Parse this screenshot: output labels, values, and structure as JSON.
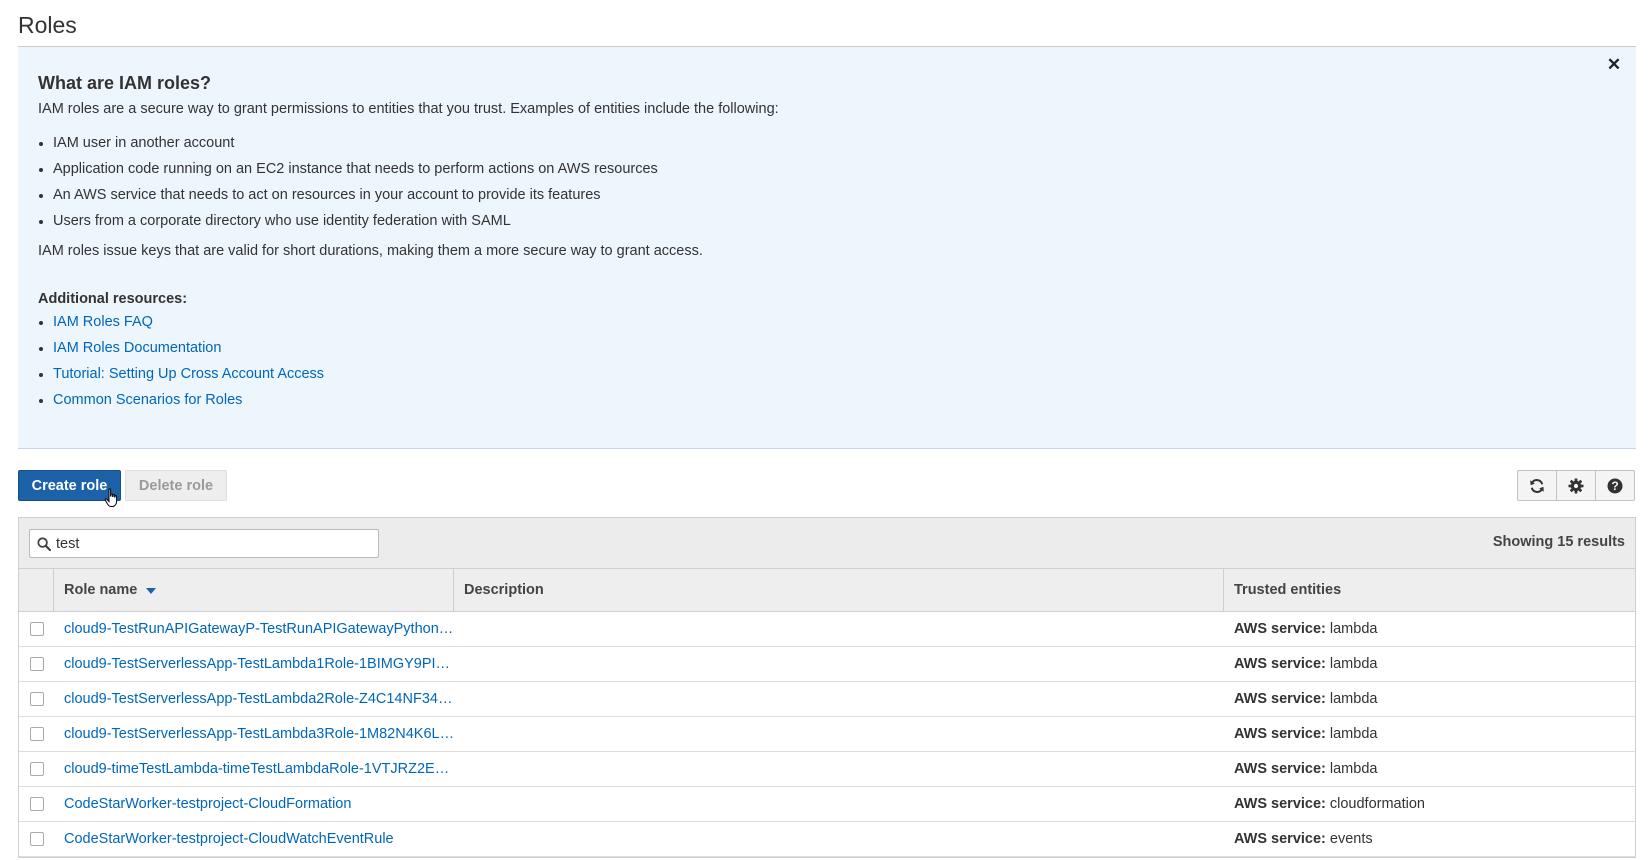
{
  "page": {
    "title": "Roles"
  },
  "info": {
    "heading": "What are IAM roles?",
    "intro": "IAM roles are a secure way to grant permissions to entities that you trust. Examples of entities include the following:",
    "examples": [
      "IAM user in another account",
      "Application code running on an EC2 instance that needs to perform actions on AWS resources",
      "An AWS service that needs to act on resources in your account to provide its features",
      "Users from a corporate directory who use identity federation with SAML"
    ],
    "summary": "IAM roles issue keys that are valid for short durations, making them a more secure way to grant access.",
    "resources_heading": "Additional resources:",
    "resources": [
      "IAM Roles FAQ",
      "IAM Roles Documentation",
      "Tutorial: Setting Up Cross Account Access",
      "Common Scenarios for Roles"
    ],
    "close_icon": "close-icon"
  },
  "toolbar": {
    "create_label": "Create role",
    "delete_label": "Delete role",
    "icons": [
      "refresh-icon",
      "gear-icon",
      "help-icon"
    ]
  },
  "filter": {
    "value": "test",
    "results": "Showing 15 results"
  },
  "table": {
    "columns": [
      "Role name",
      "Description",
      "Trusted entities"
    ],
    "sort_column": "Role name",
    "rows": [
      {
        "name": "cloud9-TestRunAPIGatewayP-TestRunAPIGatewayPython…",
        "description": "",
        "trust_label": "AWS service:",
        "trust_value": "lambda"
      },
      {
        "name": "cloud9-TestServerlessApp-TestLambda1Role-1BIMGY9PI…",
        "description": "",
        "trust_label": "AWS service:",
        "trust_value": "lambda"
      },
      {
        "name": "cloud9-TestServerlessApp-TestLambda2Role-Z4C14NF34…",
        "description": "",
        "trust_label": "AWS service:",
        "trust_value": "lambda"
      },
      {
        "name": "cloud9-TestServerlessApp-TestLambda3Role-1M82N4K6L…",
        "description": "",
        "trust_label": "AWS service:",
        "trust_value": "lambda"
      },
      {
        "name": "cloud9-timeTestLambda-timeTestLambdaRole-1VTJRZ2E…",
        "description": "",
        "trust_label": "AWS service:",
        "trust_value": "lambda"
      },
      {
        "name": "CodeStarWorker-testproject-CloudFormation",
        "description": "",
        "trust_label": "AWS service:",
        "trust_value": "cloudformation"
      },
      {
        "name": "CodeStarWorker-testproject-CloudWatchEventRule",
        "description": "",
        "trust_label": "AWS service:",
        "trust_value": "events"
      }
    ]
  },
  "colors": {
    "primary_button": "#1d62a8",
    "info_background": "#edf5fd",
    "link": "#0066bb"
  }
}
